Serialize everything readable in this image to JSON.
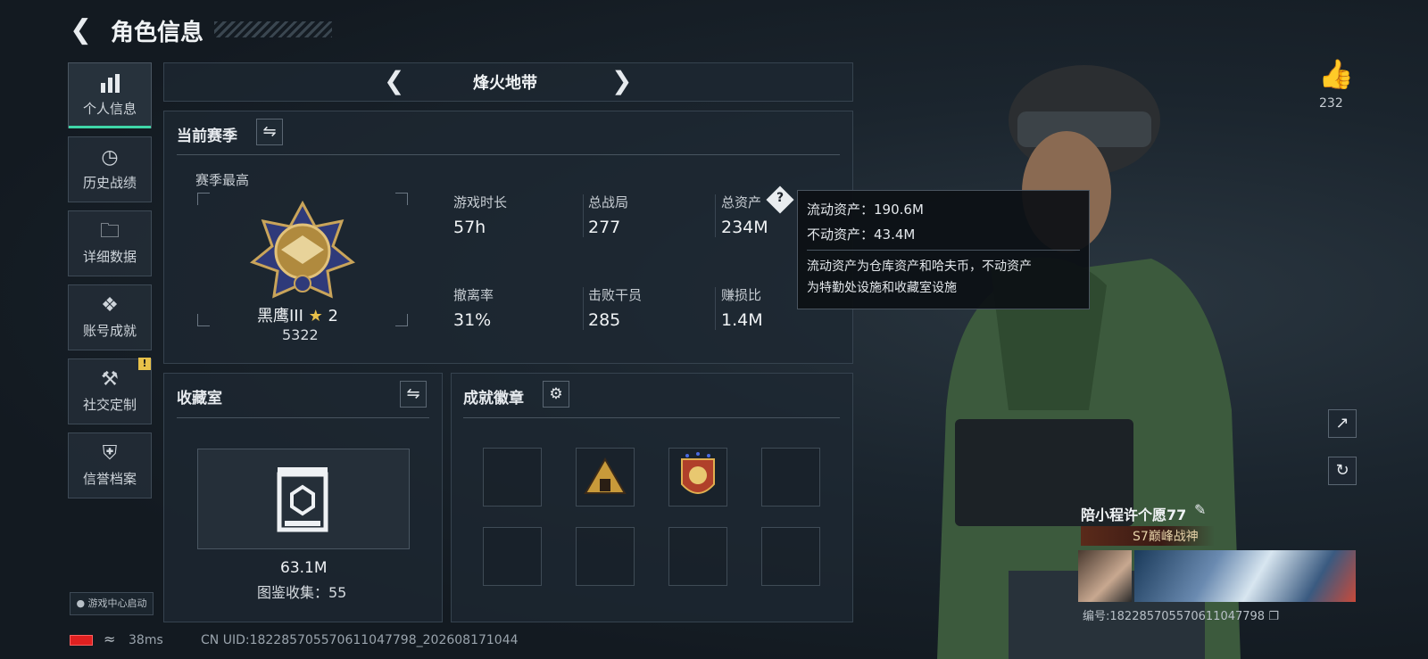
{
  "header": {
    "back_icon": "chevron-left-icon",
    "title": "角色信息"
  },
  "sidebar": {
    "items": [
      {
        "label": "个人信息",
        "icon": "bar-chart-icon",
        "active": true
      },
      {
        "label": "历史战绩",
        "icon": "clock-icon"
      },
      {
        "label": "详细数据",
        "icon": "folder-icon"
      },
      {
        "label": "账号成就",
        "icon": "medal-icon"
      },
      {
        "label": "社交定制",
        "icon": "tools-icon",
        "badge": "!"
      },
      {
        "label": "信誉档案",
        "icon": "shield-icon"
      }
    ],
    "launch_label": "游戏中心启动"
  },
  "mode_selector": {
    "label": "烽火地带"
  },
  "season": {
    "title": "当前赛季",
    "best_label": "赛季最高",
    "rank_name": "黑鹰III",
    "rank_stars": "2",
    "rank_score": "5322",
    "stats": [
      {
        "label": "游戏时长",
        "value": "57h"
      },
      {
        "label": "总战局",
        "value": "277"
      },
      {
        "label": "总资产",
        "value": "234M"
      },
      {
        "label": "撤离率",
        "value": "31%"
      },
      {
        "label": "击败干员",
        "value": "285"
      },
      {
        "label": "赚损比",
        "value": "1.4M"
      }
    ]
  },
  "tooltip": {
    "line1": "流动资产：190.6M",
    "line2": "不动资产：43.4M",
    "desc1": "流动资产为仓库资产和哈夫币，不动资产",
    "desc2": "为特勤处设施和收藏室设施"
  },
  "collection": {
    "title": "收藏室",
    "value": "63.1M",
    "count_label": "图鉴收集：55"
  },
  "badges": {
    "title": "成就徽章"
  },
  "like": {
    "count": "232"
  },
  "player": {
    "name": "陪小程许个愿77",
    "title": "S7巅峰战神",
    "id_text": "编号:1822857055706110477​98"
  },
  "status": {
    "ping": "38ms",
    "uid": "CN UID:1822857055706110477​98_202608171044"
  },
  "colors": {
    "accent": "#3fd6a8",
    "badge": "#e8c14a",
    "battery": "#e02020"
  }
}
